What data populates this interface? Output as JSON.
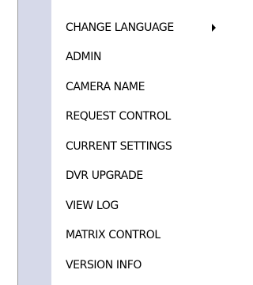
{
  "menu": {
    "items": [
      {
        "label": "CHANGE LANGUAGE",
        "has_submenu": true
      },
      {
        "label": "ADMIN",
        "has_submenu": false
      },
      {
        "label": "CAMERA NAME",
        "has_submenu": false
      },
      {
        "label": "REQUEST CONTROL",
        "has_submenu": false
      },
      {
        "label": "CURRENT SETTINGS",
        "has_submenu": false
      },
      {
        "label": "DVR UPGRADE",
        "has_submenu": false
      },
      {
        "label": "VIEW LOG",
        "has_submenu": false
      },
      {
        "label": "MATRIX CONTROL",
        "has_submenu": false
      },
      {
        "label": "VERSION INFO",
        "has_submenu": false
      }
    ],
    "colors": {
      "gutter": "#d6d9e9",
      "background": "#ffffff",
      "text": "#000000",
      "border": "#9a9a9a"
    }
  }
}
